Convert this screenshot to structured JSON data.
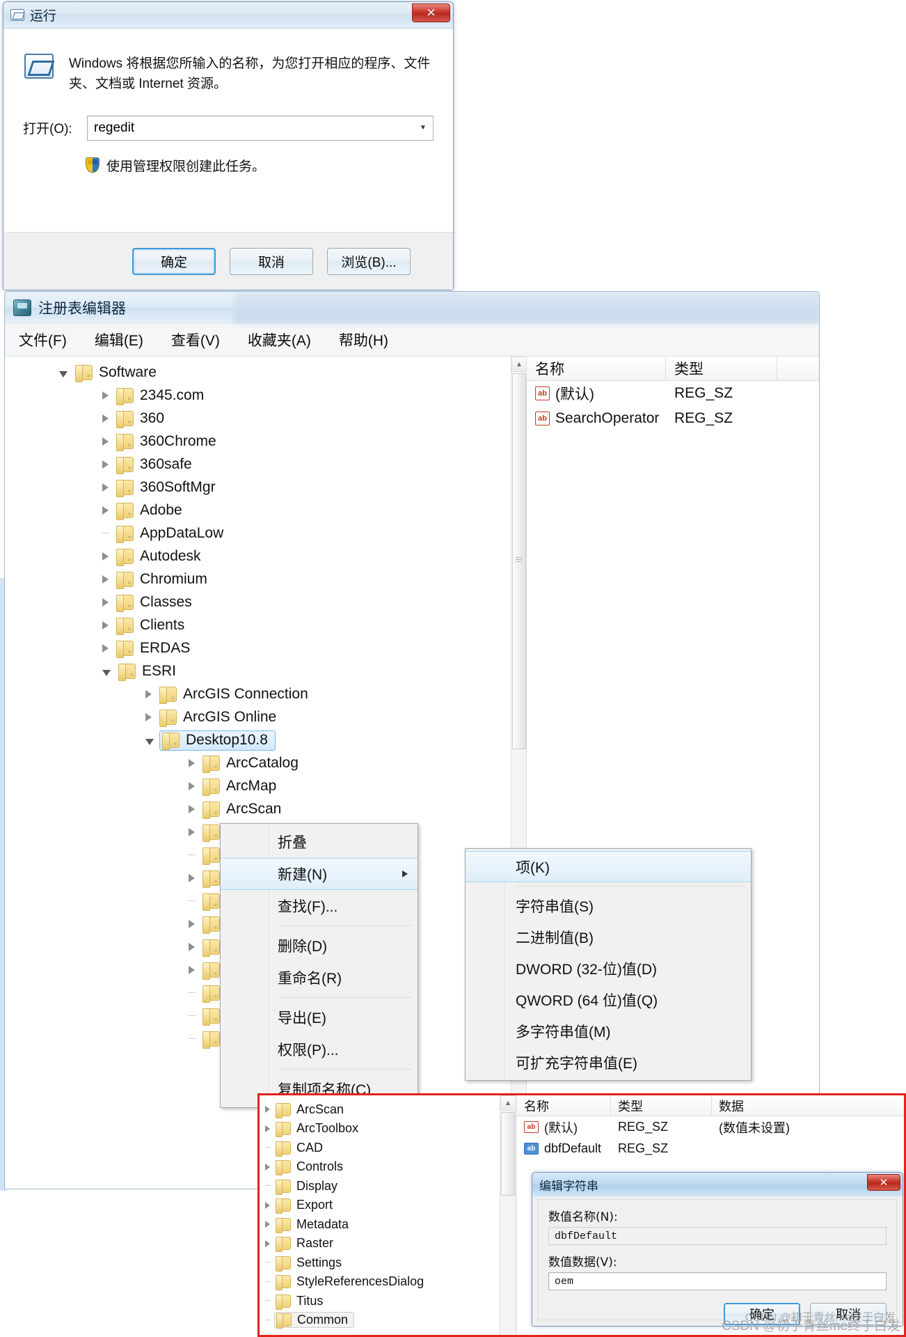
{
  "run_dialog": {
    "title": "运行",
    "icon": "run-window-icon",
    "close_label": "✕",
    "description": "Windows 将根据您所输入的名称，为您打开相应的程序、文件夹、文档或 Internet 资源。",
    "open_label": "打开(O):",
    "open_value": "regedit",
    "open_placeholder": "",
    "elevate_text": "使用管理权限创建此任务。",
    "buttons": [
      {
        "label": "确定",
        "default": true
      },
      {
        "label": "取消",
        "default": false
      },
      {
        "label": "浏览(B)...",
        "default": false
      }
    ]
  },
  "regedit": {
    "title": "注册表编辑器",
    "icon": "registry-editor-icon",
    "menus": [
      "文件(F)",
      "编辑(E)",
      "查看(V)",
      "收藏夹(A)",
      "帮助(H)"
    ],
    "tree": [
      {
        "label": "Software",
        "depth": 0,
        "expander": "open",
        "selected": false
      },
      {
        "label": "2345.com",
        "depth": 1,
        "expander": "closed",
        "selected": false
      },
      {
        "label": "360",
        "depth": 1,
        "expander": "closed",
        "selected": false
      },
      {
        "label": "360Chrome",
        "depth": 1,
        "expander": "closed",
        "selected": false
      },
      {
        "label": "360safe",
        "depth": 1,
        "expander": "closed",
        "selected": false
      },
      {
        "label": "360SoftMgr",
        "depth": 1,
        "expander": "closed",
        "selected": false
      },
      {
        "label": "Adobe",
        "depth": 1,
        "expander": "closed",
        "selected": false
      },
      {
        "label": "AppDataLow",
        "depth": 1,
        "expander": "none",
        "selected": false
      },
      {
        "label": "Autodesk",
        "depth": 1,
        "expander": "closed",
        "selected": false
      },
      {
        "label": "Chromium",
        "depth": 1,
        "expander": "closed",
        "selected": false
      },
      {
        "label": "Classes",
        "depth": 1,
        "expander": "closed",
        "selected": false
      },
      {
        "label": "Clients",
        "depth": 1,
        "expander": "closed",
        "selected": false
      },
      {
        "label": "ERDAS",
        "depth": 1,
        "expander": "closed",
        "selected": false
      },
      {
        "label": "ESRI",
        "depth": 1,
        "expander": "open",
        "selected": false
      },
      {
        "label": "ArcGIS Connection",
        "depth": 2,
        "expander": "closed",
        "selected": false
      },
      {
        "label": "ArcGIS Online",
        "depth": 2,
        "expander": "closed",
        "selected": false
      },
      {
        "label": "Desktop10.8",
        "depth": 2,
        "expander": "open",
        "selected": true
      },
      {
        "label": "ArcCatalog",
        "depth": 3,
        "expander": "closed",
        "selected": false
      },
      {
        "label": "ArcMap",
        "depth": 3,
        "expander": "closed",
        "selected": false
      },
      {
        "label": "ArcScan",
        "depth": 3,
        "expander": "closed",
        "selected": false
      },
      {
        "label": "ArcToolbox",
        "depth": 3,
        "expander": "closed",
        "selected": false
      },
      {
        "label": "CAD",
        "depth": 3,
        "expander": "none",
        "selected": false
      },
      {
        "label": "Controls",
        "depth": 3,
        "expander": "closed",
        "selected": false
      },
      {
        "label": "Display",
        "depth": 3,
        "expander": "none",
        "selected": false
      },
      {
        "label": "Export",
        "depth": 3,
        "expander": "closed",
        "selected": false
      },
      {
        "label": "Metadata",
        "depth": 3,
        "expander": "closed",
        "selected": false
      },
      {
        "label": "Raster",
        "depth": 3,
        "expander": "closed",
        "selected": false
      },
      {
        "label": "Settings",
        "depth": 3,
        "expander": "none",
        "selected": false
      },
      {
        "label": "StyleReferencesDialog",
        "depth": 3,
        "expander": "none",
        "selected": false
      },
      {
        "label": "Titus",
        "depth": 3,
        "expander": "none",
        "selected": false
      }
    ],
    "list": {
      "columns": [
        "名称",
        "类型"
      ],
      "rows": [
        {
          "icon": "string-value-icon",
          "name": "(默认)",
          "type": "REG_SZ"
        },
        {
          "icon": "string-value-icon",
          "name": "SearchOperator",
          "type": "REG_SZ"
        }
      ]
    }
  },
  "context_menu": {
    "items": [
      {
        "label": "折叠",
        "highlight": false,
        "submenu": false,
        "separator_after": false
      },
      {
        "label": "新建(N)",
        "highlight": true,
        "submenu": true,
        "separator_after": false
      },
      {
        "label": "查找(F)...",
        "highlight": false,
        "submenu": false,
        "separator_after": true
      },
      {
        "label": "删除(D)",
        "highlight": false,
        "submenu": false,
        "separator_after": false
      },
      {
        "label": "重命名(R)",
        "highlight": false,
        "submenu": false,
        "separator_after": true
      },
      {
        "label": "导出(E)",
        "highlight": false,
        "submenu": false,
        "separator_after": false
      },
      {
        "label": "权限(P)...",
        "highlight": false,
        "submenu": false,
        "separator_after": true
      },
      {
        "label": "复制项名称(C)",
        "highlight": false,
        "submenu": false,
        "separator_after": false
      }
    ]
  },
  "submenu": {
    "items": [
      {
        "label": "项(K)",
        "highlight": true,
        "separator_after": true
      },
      {
        "label": "字符串值(S)",
        "highlight": false,
        "separator_after": false
      },
      {
        "label": "二进制值(B)",
        "highlight": false,
        "separator_after": false
      },
      {
        "label": "DWORD (32-位)值(D)",
        "highlight": false,
        "separator_after": false
      },
      {
        "label": "QWORD (64 位)值(Q)",
        "highlight": false,
        "separator_after": false
      },
      {
        "label": "多字符串值(M)",
        "highlight": false,
        "separator_after": false
      },
      {
        "label": "可扩充字符串值(E)",
        "highlight": false,
        "separator_after": false
      }
    ]
  },
  "bottom_window": {
    "tree": [
      {
        "label": "ArcScan",
        "expander": "closed",
        "selected": false
      },
      {
        "label": "ArcToolbox",
        "expander": "closed",
        "selected": false
      },
      {
        "label": "CAD",
        "expander": "none",
        "selected": false
      },
      {
        "label": "Controls",
        "expander": "closed",
        "selected": false
      },
      {
        "label": "Display",
        "expander": "none",
        "selected": false
      },
      {
        "label": "Export",
        "expander": "closed",
        "selected": false
      },
      {
        "label": "Metadata",
        "expander": "closed",
        "selected": false
      },
      {
        "label": "Raster",
        "expander": "closed",
        "selected": false
      },
      {
        "label": "Settings",
        "expander": "none",
        "selected": false
      },
      {
        "label": "StyleReferencesDialog",
        "expander": "none",
        "selected": false
      },
      {
        "label": "Titus",
        "expander": "none",
        "selected": false
      },
      {
        "label": "Common",
        "expander": "none",
        "selected": true
      }
    ],
    "list": {
      "columns": [
        "名称",
        "类型",
        "数据"
      ],
      "rows": [
        {
          "icon": "string-value-icon",
          "name": "(默认)",
          "type": "REG_SZ",
          "data": "(数值未设置)"
        },
        {
          "icon": "string-value-icon-blue",
          "name": "dbfDefault",
          "type": "REG_SZ",
          "data": ""
        }
      ]
    }
  },
  "edit_string": {
    "title": "编辑字符串",
    "close_label": "✕",
    "name_label": "数值名称(N):",
    "name_value": "dbfDefault",
    "data_label": "数值数据(V):",
    "data_value": "oem",
    "buttons": [
      {
        "label": "确定",
        "default": true
      },
      {
        "label": "取消",
        "default": false
      }
    ]
  },
  "watermark": "CSDN @初于青丝me终于白发",
  "dialog_watermark": "CSDN @初于青丝me终于白发",
  "colors": {
    "highlight_border": "#e2231a",
    "selection": "#d3e8fb",
    "close_button": "#cf3f35"
  }
}
